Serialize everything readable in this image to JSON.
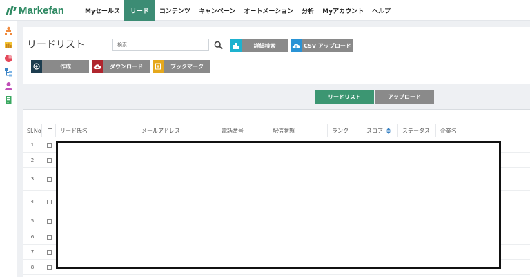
{
  "app": {
    "logo_text": "Markefan"
  },
  "nav": {
    "items": [
      {
        "label": "Myセールス",
        "active": false
      },
      {
        "label": "リード",
        "active": true
      },
      {
        "label": "コンテンツ",
        "active": false
      },
      {
        "label": "キャンペーン",
        "active": false
      },
      {
        "label": "オートメーション",
        "active": false
      },
      {
        "label": "分析",
        "active": false
      },
      {
        "label": "Myアカウント",
        "active": false
      },
      {
        "label": "ヘルプ",
        "active": false
      }
    ]
  },
  "page": {
    "title": "リードリスト",
    "search_placeholder": "検索"
  },
  "toolbar": {
    "advanced_search": "詳細検索",
    "csv_upload": "CSV アップロード",
    "create": "作成",
    "download": "ダウンロード",
    "bookmark": "ブックマーク"
  },
  "tabs": [
    {
      "label": "リードリスト",
      "active": true
    },
    {
      "label": "アップロード",
      "active": false
    }
  ],
  "table": {
    "columns": {
      "no": "Sl.No",
      "name": "リード氏名",
      "email": "メールアドレス",
      "phone": "電話番号",
      "delivery": "配信状態",
      "rank": "ランク",
      "score": "スコア",
      "status": "ステータス",
      "company": "企業名"
    },
    "rows": [
      "1",
      "2",
      "3",
      "4",
      "5",
      "6",
      "7",
      "8"
    ]
  },
  "colors": {
    "brand": "#2f8a63",
    "nav_active": "#3c8c74",
    "btn_gray": "#8a8a8a",
    "btn_teal": "#1eb2cf",
    "btn_blue": "#2a93d5",
    "btn_dark": "#1d3d4f",
    "btn_red": "#b0262e",
    "btn_amber": "#e5a81d"
  }
}
